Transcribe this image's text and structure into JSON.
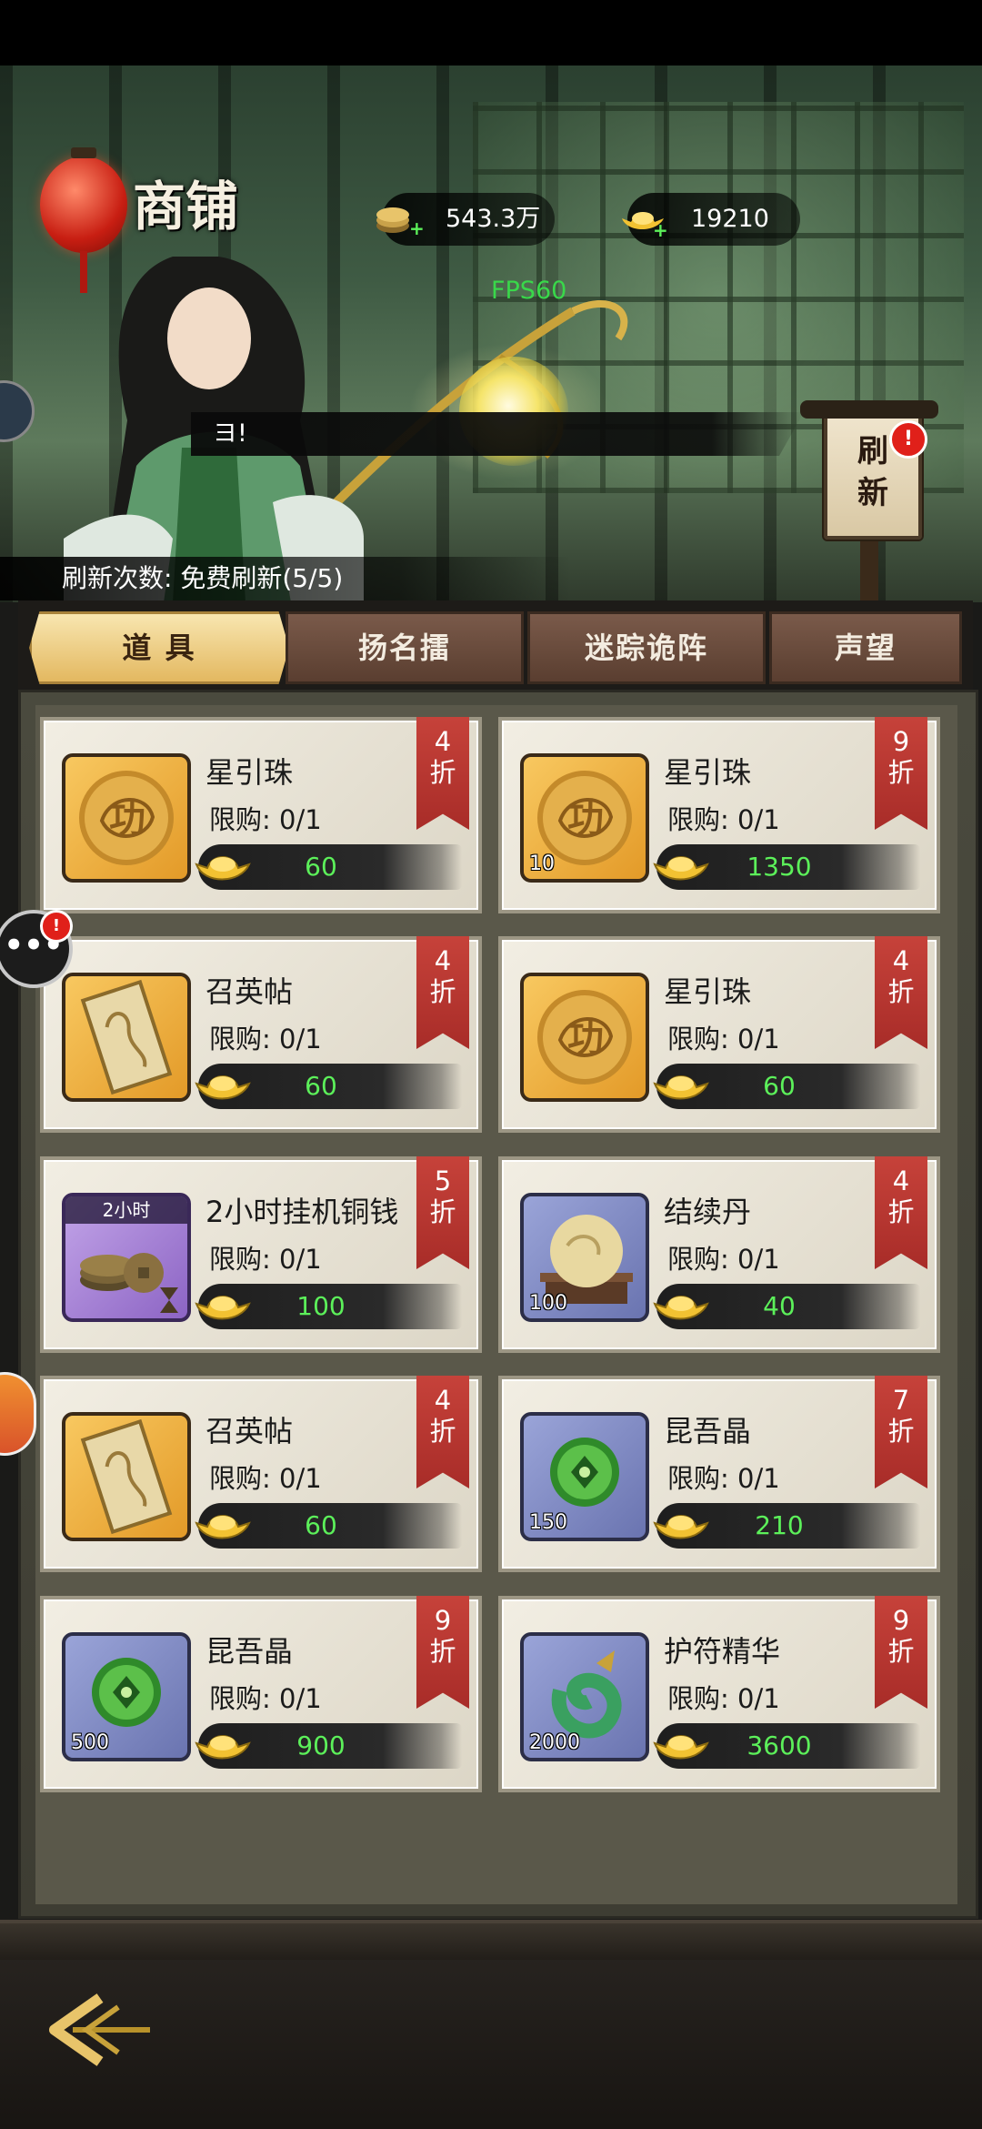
{
  "header": {
    "shop_title": "商铺",
    "coins": "543.3万",
    "ingots": "19210",
    "fps": "FPS60"
  },
  "npc": {
    "speech": "ヨ!"
  },
  "refresh": {
    "sign_label": "刷\n新",
    "badge": "!",
    "count_text": "刷新次数:  免费刷新(5/5)"
  },
  "side": {
    "chat_label": "•••",
    "chat_badge": "!"
  },
  "tabs": [
    {
      "label": "道 具",
      "active": true
    },
    {
      "label": "扬名擂",
      "active": false
    },
    {
      "label": "迷踪诡阵",
      "active": false
    },
    {
      "label": "声望",
      "active": false
    }
  ],
  "items": [
    {
      "name": "星引珠",
      "limit": "限购:  0/1",
      "price": "60",
      "discount": [
        "4",
        "折"
      ],
      "qty": "",
      "tag": "",
      "icon": "star-bead-icon",
      "frame": "gold"
    },
    {
      "name": "星引珠",
      "limit": "限购:  0/1",
      "price": "1350",
      "discount": [
        "9",
        "折"
      ],
      "qty": "10",
      "tag": "",
      "icon": "star-bead-icon",
      "frame": "gold"
    },
    {
      "name": "召英帖",
      "limit": "限购:  0/1",
      "price": "60",
      "discount": [
        "4",
        "折"
      ],
      "qty": "",
      "tag": "",
      "icon": "summon-ticket-icon",
      "frame": "gold"
    },
    {
      "name": "星引珠",
      "limit": "限购:  0/1",
      "price": "60",
      "discount": [
        "4",
        "折"
      ],
      "qty": "",
      "tag": "",
      "icon": "star-bead-icon",
      "frame": "gold"
    },
    {
      "name": "2小时挂机铜钱",
      "limit": "限购:  0/1",
      "price": "100",
      "discount": [
        "5",
        "折"
      ],
      "qty": "",
      "tag": "2小时",
      "icon": "copper-coins-icon",
      "frame": "purple"
    },
    {
      "name": "结续丹",
      "limit": "限购:  0/1",
      "price": "40",
      "discount": [
        "4",
        "折"
      ],
      "qty": "100",
      "tag": "",
      "icon": "pill-icon",
      "frame": "blue"
    },
    {
      "name": "召英帖",
      "limit": "限购:  0/1",
      "price": "60",
      "discount": [
        "4",
        "折"
      ],
      "qty": "",
      "tag": "",
      "icon": "summon-ticket-icon",
      "frame": "gold"
    },
    {
      "name": "昆吾晶",
      "limit": "限购:  0/1",
      "price": "210",
      "discount": [
        "7",
        "折"
      ],
      "qty": "150",
      "tag": "",
      "icon": "green-crystal-icon",
      "frame": "blue"
    },
    {
      "name": "昆吾晶",
      "limit": "限购:  0/1",
      "price": "900",
      "discount": [
        "9",
        "折"
      ],
      "qty": "500",
      "tag": "",
      "icon": "green-crystal-icon",
      "frame": "blue"
    },
    {
      "name": "护符精华",
      "limit": "限购:  0/1",
      "price": "3600",
      "discount": [
        "9",
        "折"
      ],
      "qty": "2000",
      "tag": "",
      "icon": "jade-amulet-icon",
      "frame": "blue"
    }
  ],
  "colors": {
    "price_green": "#5cf05a",
    "discount_red": "#b8352f",
    "active_tab_gold": "#e3b860"
  }
}
